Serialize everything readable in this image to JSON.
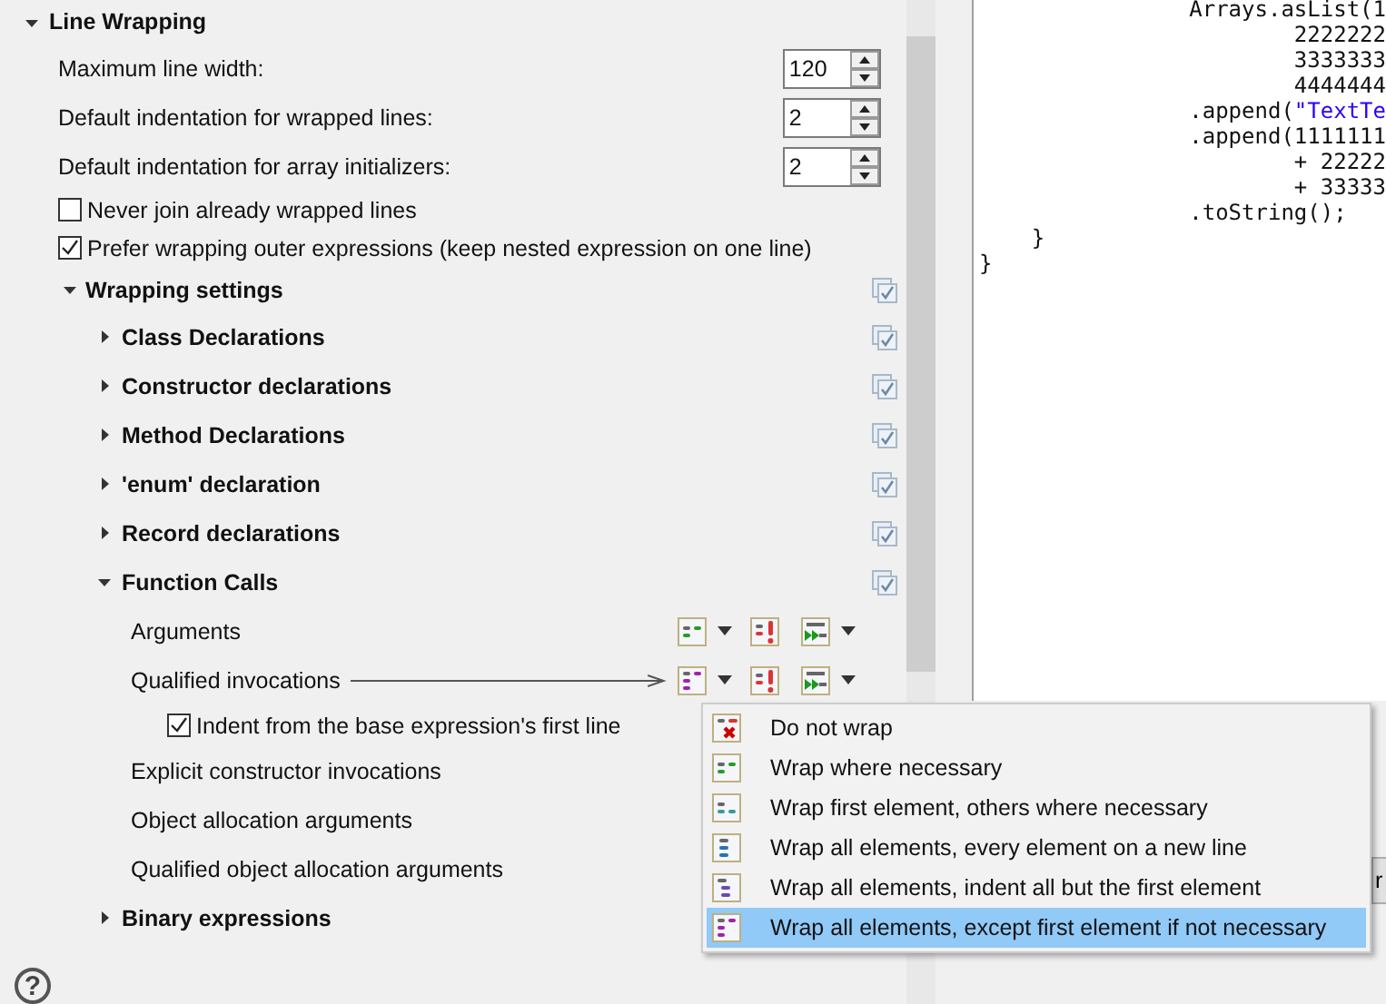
{
  "section": {
    "title": "Line Wrapping",
    "expanded": true
  },
  "fields": [
    {
      "label": "Maximum line width:",
      "value": "120"
    },
    {
      "label": "Default indentation for wrapped lines:",
      "value": "2"
    },
    {
      "label": "Default indentation for array initializers:",
      "value": "2"
    }
  ],
  "checkboxes": [
    {
      "label": "Never join already wrapped lines",
      "checked": false
    },
    {
      "label": "Prefer wrapping outer expressions (keep nested expression on one line)",
      "checked": true
    }
  ],
  "wrapping_settings": {
    "title": "Wrapping settings",
    "expanded": true,
    "checked": true,
    "groups": [
      {
        "title": "Class Declarations",
        "expanded": false,
        "checked": true
      },
      {
        "title": "Constructor declarations",
        "expanded": false,
        "checked": true
      },
      {
        "title": "Method Declarations",
        "expanded": false,
        "checked": true
      },
      {
        "title": "'enum' declaration",
        "expanded": false,
        "checked": true
      },
      {
        "title": "Record declarations",
        "expanded": false,
        "checked": true
      },
      {
        "title": "Function Calls",
        "expanded": true,
        "checked": true,
        "children": [
          {
            "kind": "setting",
            "label": "Arguments",
            "policy": {
              "kind": "where_necessary"
            },
            "pointer": false
          },
          {
            "kind": "setting",
            "label": "Qualified invocations",
            "policy": {
              "kind": "except_first"
            },
            "pointer": true
          },
          {
            "kind": "checkbox",
            "label": "Indent from the base expression's first line",
            "checked": true
          },
          {
            "kind": "setting",
            "label": "Explicit constructor invocations",
            "pointer": false
          },
          {
            "kind": "setting",
            "label": "Object allocation arguments",
            "pointer": false
          },
          {
            "kind": "setting",
            "label": "Qualified object allocation arguments",
            "pointer": false
          }
        ]
      },
      {
        "title": "Binary expressions",
        "expanded": false
      }
    ]
  },
  "help_button": "?",
  "preview": {
    "lines": [
      {
        "text": "                Arrays.asList(1"
      },
      {
        "text": "                        2222222"
      },
      {
        "text": "                        3333333"
      },
      {
        "text": "                        4444444"
      },
      {
        "text": "                .append(",
        "string": "\"TextTe"
      },
      {
        "text": "                .append(1111111"
      },
      {
        "text": "                        + 22222"
      },
      {
        "text": "                        + 33333"
      },
      {
        "text": "                .toString();"
      },
      {
        "text": "    }"
      },
      {
        "text": "}"
      }
    ]
  },
  "hidden_button": "r",
  "policy_menu": [
    {
      "kind": "no_wrap",
      "label": "Do not wrap",
      "selected": false
    },
    {
      "kind": "where_necessary",
      "label": "Wrap where necessary",
      "selected": false
    },
    {
      "kind": "first_element",
      "label": "Wrap first element, others where necessary",
      "selected": false
    },
    {
      "kind": "all_elements",
      "label": "Wrap all elements, every element on a new line",
      "selected": false
    },
    {
      "kind": "indent_all_but_first",
      "label": "Wrap all elements, indent all but the first element",
      "selected": false
    },
    {
      "kind": "except_first",
      "label": "Wrap all elements, except first element if not necessary",
      "selected": true
    }
  ]
}
